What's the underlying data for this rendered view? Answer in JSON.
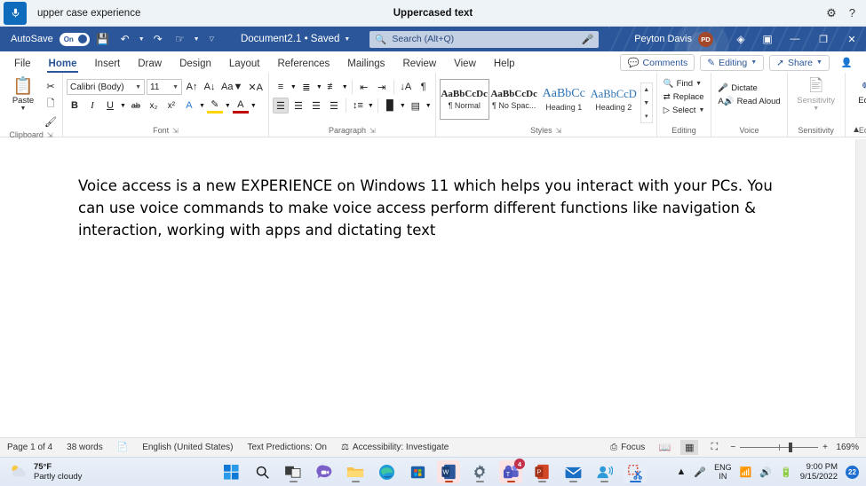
{
  "voice_access": {
    "mic_icon": "microphone-icon",
    "status_text": "upper case experience",
    "center_title": "Uppercased text",
    "settings_icon": "gear-icon",
    "help_icon": "help-icon"
  },
  "title_bar": {
    "autosave_label": "AutoSave",
    "autosave_state": "On",
    "save_icon": "save-icon",
    "undo_icon": "undo-icon",
    "redo_icon": "redo-icon",
    "touch_icon": "touch-mode-icon",
    "customize_icon": "customize-qat-icon",
    "document_name": "Document2.1  •  Saved",
    "search_placeholder": "Search (Alt+Q)",
    "search_icon": "search-icon",
    "search_mic_icon": "microphone-icon",
    "user_name": "Peyton Davis",
    "user_initials": "PD",
    "diamond_icon": "diamond-icon",
    "ribbon_display_icon": "ribbon-display-options-icon",
    "minimize": "—",
    "restore": "❐",
    "close": "✕",
    "accent": "#2b579a"
  },
  "ribbon": {
    "tabs": [
      {
        "label": "File",
        "active": false
      },
      {
        "label": "Home",
        "active": true
      },
      {
        "label": "Insert",
        "active": false
      },
      {
        "label": "Draw",
        "active": false
      },
      {
        "label": "Design",
        "active": false
      },
      {
        "label": "Layout",
        "active": false
      },
      {
        "label": "References",
        "active": false
      },
      {
        "label": "Mailings",
        "active": false
      },
      {
        "label": "Review",
        "active": false
      },
      {
        "label": "View",
        "active": false
      },
      {
        "label": "Help",
        "active": false
      }
    ],
    "comments_label": "Comments",
    "editing_label": "Editing",
    "share_label": "Share",
    "collapse_icon": "chevron-up-icon",
    "groups": {
      "clipboard": {
        "label": "Clipboard",
        "paste_label": "Paste",
        "cut_label": "Cut",
        "copy_label": "Copy",
        "format_painter_label": "Format Painter"
      },
      "font": {
        "label": "Font",
        "font_family": "Calibri (Body)",
        "font_size": "11",
        "grow_font": "A",
        "shrink_font": "A",
        "change_case": "Aa",
        "clear_formatting": "A",
        "bold": "B",
        "italic": "I",
        "underline": "U",
        "strikethrough": "ab",
        "subscript": "x",
        "superscript": "x",
        "text_effects": "A",
        "highlight": "A",
        "font_color": "A"
      },
      "paragraph": {
        "label": "Paragraph",
        "bullets": "bullet-list-icon",
        "numbering": "numbered-list-icon",
        "multilevel": "multilevel-list-icon",
        "decrease_indent": "decrease-indent-icon",
        "increase_indent": "increase-indent-icon",
        "sort": "sort-icon",
        "show_marks": "¶",
        "align_left": "align-left-icon",
        "align_center": "align-center-icon",
        "align_right": "align-right-icon",
        "justify": "justify-icon",
        "line_spacing": "line-spacing-icon",
        "shading": "shading-icon",
        "borders": "borders-icon"
      },
      "styles": {
        "label": "Styles",
        "items": [
          {
            "preview": "AaBbCcDc",
            "name": "¶ Normal",
            "kind": "normal",
            "selected": true
          },
          {
            "preview": "AaBbCcDc",
            "name": "¶ No Spac...",
            "kind": "normal",
            "selected": false
          },
          {
            "preview": "AaBbCc",
            "name": "Heading 1",
            "kind": "h1",
            "selected": false
          },
          {
            "preview": "AaBbCcD",
            "name": "Heading 2",
            "kind": "h2",
            "selected": false
          }
        ]
      },
      "editing": {
        "label": "Editing",
        "find_label": "Find",
        "replace_label": "Replace",
        "select_label": "Select"
      },
      "voice": {
        "label": "Voice",
        "dictate_label": "Dictate",
        "read_aloud_label": "Read Aloud"
      },
      "sensitivity": {
        "label": "Sensitivity",
        "button_label": "Sensitivity"
      },
      "editor": {
        "label": "Editor",
        "button_label": "Editor"
      }
    }
  },
  "document": {
    "body_text": "Voice access is a new EXPERIENCE on Windows 11 which helps you interact with your PCs. You can use voice commands to make voice access perform different functions like navigation & interaction, working with apps and dictating text"
  },
  "status_bar": {
    "page": "Page 1 of 4",
    "words": "38 words",
    "proofing_icon": "proofing-icon",
    "language": "English (United States)",
    "text_predictions": "Text Predictions: On",
    "accessibility": "Accessibility: Investigate",
    "accessibility_icon": "accessibility-icon",
    "focus_label": "Focus",
    "focus_icon": "focus-icon",
    "view_read": "read-mode-icon",
    "view_print": "print-layout-icon",
    "view_web": "web-layout-icon",
    "zoom_out": "−",
    "zoom_in": "+",
    "zoom_level": "169%"
  },
  "taskbar": {
    "weather_temp": "75°F",
    "weather_desc": "Partly cloudy",
    "weather_icon": "partly-cloudy-icon",
    "start_icon": "windows-start-icon",
    "search_icon": "search-icon",
    "apps": [
      {
        "name": "task-view",
        "label": "Task View"
      },
      {
        "name": "chat",
        "label": "Chat"
      },
      {
        "name": "file-explorer",
        "label": "File Explorer"
      },
      {
        "name": "edge",
        "label": "Microsoft Edge"
      },
      {
        "name": "store",
        "label": "Microsoft Store"
      },
      {
        "name": "word",
        "label": "Word"
      },
      {
        "name": "settings",
        "label": "Settings"
      },
      {
        "name": "teams",
        "label": "Microsoft Teams",
        "badge": "4"
      },
      {
        "name": "powerpoint",
        "label": "PowerPoint"
      },
      {
        "name": "mail",
        "label": "Mail"
      },
      {
        "name": "people",
        "label": "People"
      },
      {
        "name": "snipping-tool",
        "label": "Snipping Tool"
      }
    ],
    "tray": {
      "chevron_icon": "chevron-up-icon",
      "mic_icon": "microphone-icon",
      "lang_line1": "ENG",
      "lang_line2": "IN",
      "wifi_icon": "wifi-icon",
      "volume_icon": "volume-icon",
      "battery_icon": "battery-icon",
      "time": "9:00 PM",
      "date": "9/15/2022",
      "notification_count": "22"
    }
  }
}
